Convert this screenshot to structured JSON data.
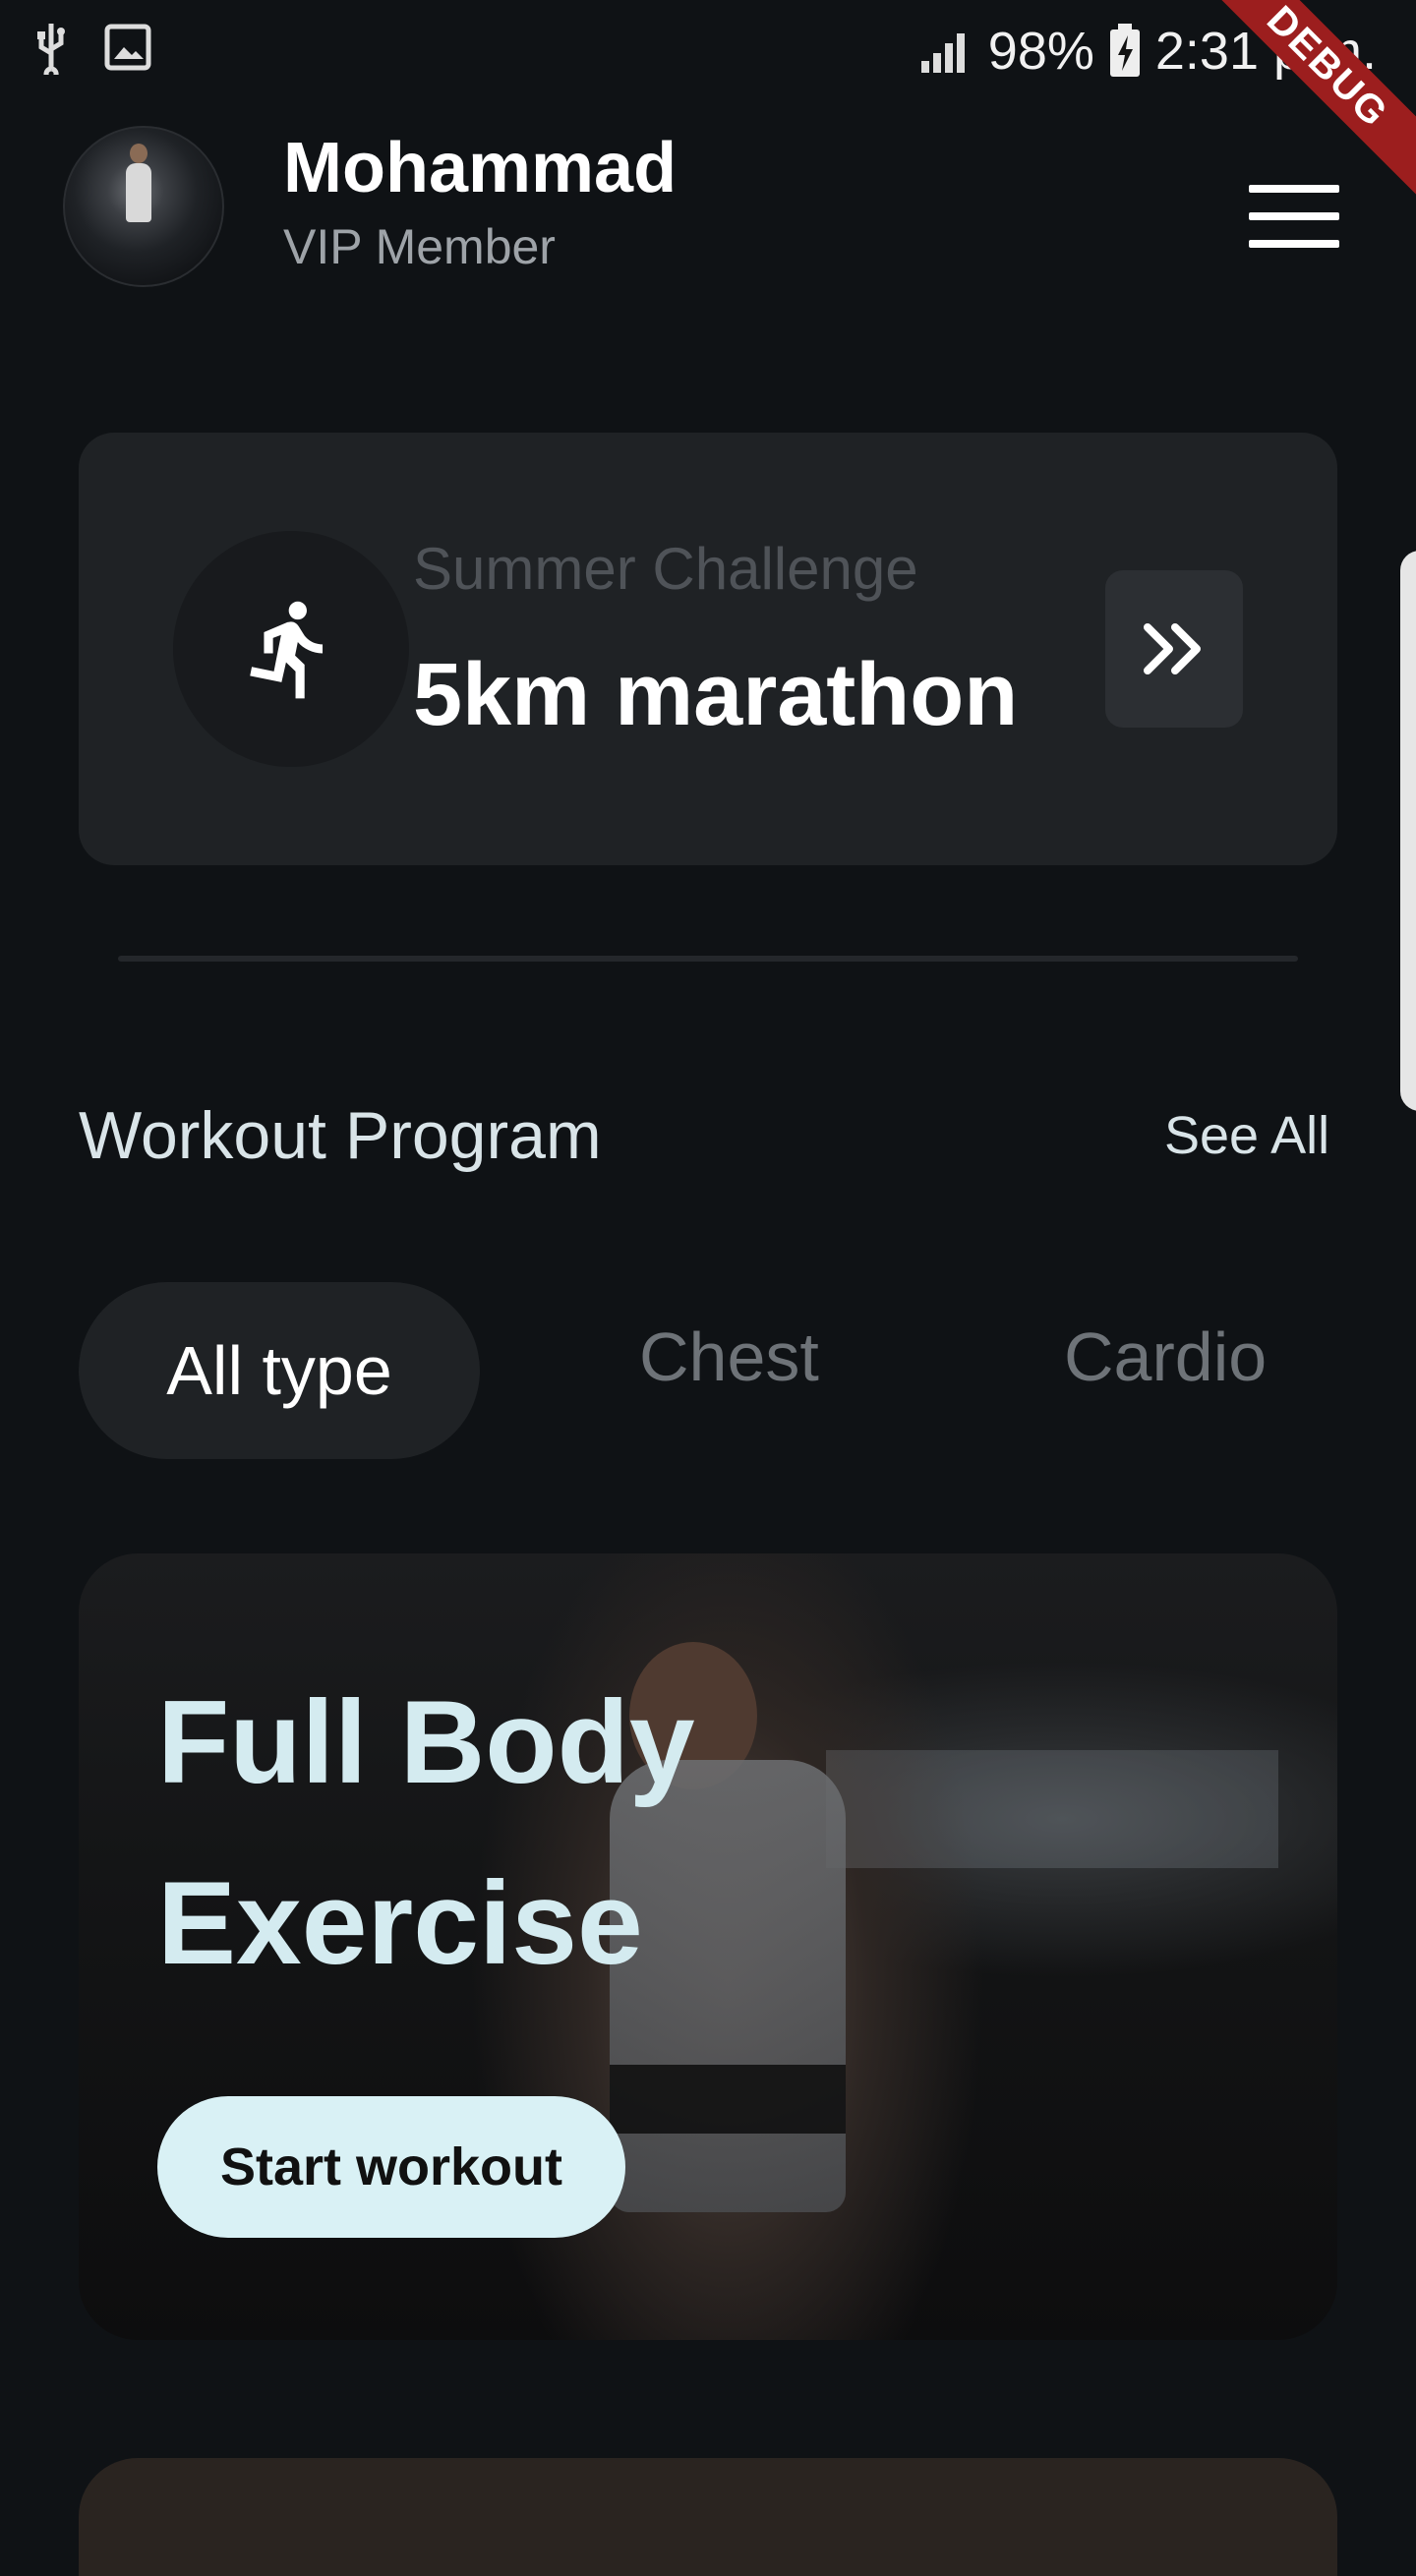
{
  "status_bar": {
    "battery": "98%",
    "time": "2:31 p.m.",
    "icons": [
      "usb-icon",
      "image-icon",
      "signal-icon",
      "battery-charging-icon"
    ]
  },
  "debug_banner": "DEBUG",
  "header": {
    "user_name": "Mohammad",
    "membership": "VIP Member",
    "menu_icon": "hamburger-menu-icon"
  },
  "challenge": {
    "subtitle": "Summer Challenge",
    "title": "5km marathon",
    "icon": "running-person-icon",
    "action_icon": "double-chevron-right-icon"
  },
  "workout_section": {
    "title": "Workout Program",
    "see_all": "See All",
    "filters": [
      {
        "label": "All type",
        "active": true
      },
      {
        "label": "Chest",
        "active": false
      },
      {
        "label": "Cardio",
        "active": false
      }
    ],
    "card": {
      "title_line1": "Full Body",
      "title_line2": "Exercise",
      "button": "Start workout"
    }
  },
  "colors": {
    "background": "#0f1215",
    "card": "#1f2225",
    "accent_button": "#d9f1f5",
    "debug_ribbon": "#9c1e1e"
  }
}
